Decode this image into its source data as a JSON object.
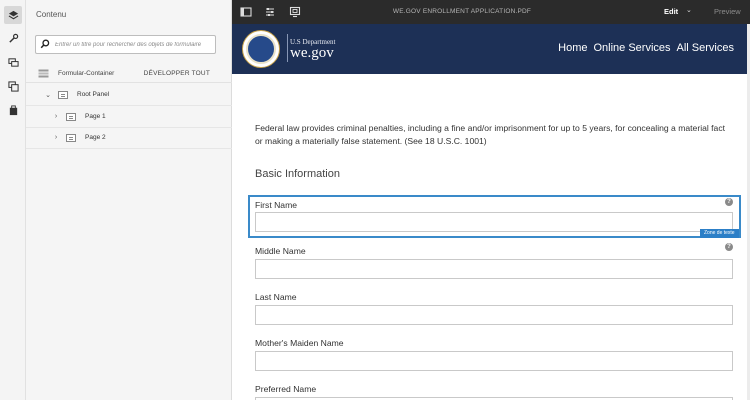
{
  "rail": {
    "items": [
      {
        "name": "layers-icon",
        "active": true
      },
      {
        "name": "wrench-icon",
        "active": false
      },
      {
        "name": "components-icon",
        "active": false
      },
      {
        "name": "data-sources-icon",
        "active": false
      },
      {
        "name": "assets-icon",
        "active": false
      }
    ]
  },
  "panel": {
    "title": "Contenu",
    "search_placeholder": "Entrer un titre pour rechercher des objets de formulaire",
    "container_label": "Formular-Container",
    "expand_all": "DÉVELOPPER TOUT",
    "tree": [
      {
        "label": "Root Panel",
        "expanded": true
      },
      {
        "label": "Page 1",
        "expanded": false
      },
      {
        "label": "Page 2",
        "expanded": false
      }
    ]
  },
  "topbar": {
    "title": "WE.GOV ENROLLMENT APPLICATION.PDF",
    "mode": "Edit",
    "preview": "Preview"
  },
  "site": {
    "dept": "U.S Department",
    "brand": "we.gov",
    "nav": [
      "Home",
      "Online Services",
      "All Services"
    ],
    "colors": {
      "header_bg": "#1d3056",
      "selection": "#3a8ac9"
    }
  },
  "form": {
    "notice": "Federal law provides criminal penalties, including a fine and/or imprisonment for up to 5 years, for concealing a material fact or making a materially false statement. (See 18 U.S.C. 1001)",
    "section_title": "Basic Information",
    "selected_tag": "Zone de texte",
    "help_glyph": "?",
    "fields": [
      {
        "label": "First Name",
        "value": ""
      },
      {
        "label": "Middle Name",
        "value": ""
      },
      {
        "label": "Last Name",
        "value": ""
      },
      {
        "label": "Mother's Maiden Name",
        "value": ""
      },
      {
        "label": "Preferred Name",
        "value": ""
      }
    ]
  }
}
